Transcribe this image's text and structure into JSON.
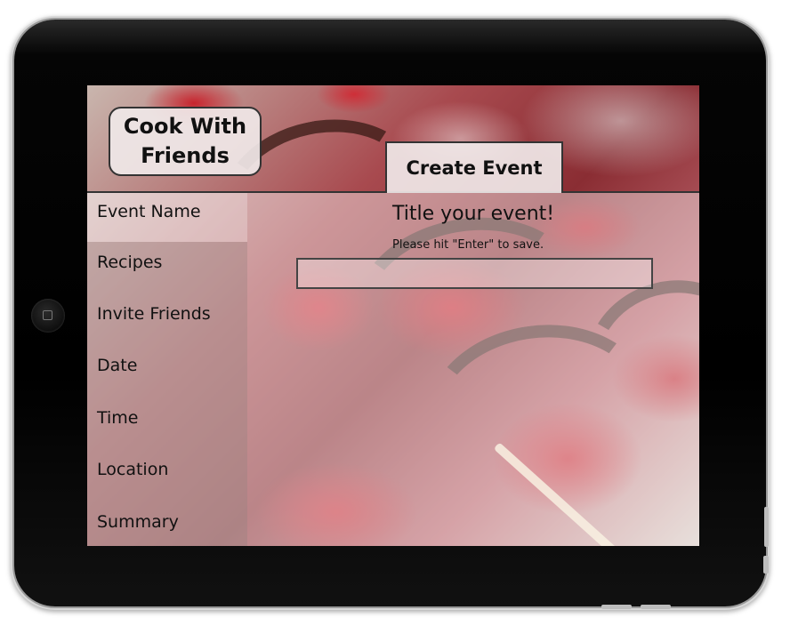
{
  "app": {
    "logo_text": "Cook With Friends",
    "logo_line1": "Cook With",
    "logo_line2": "Friends"
  },
  "header": {
    "active_tab": "Create Event"
  },
  "sidebar": {
    "items": [
      {
        "label": "Event Name",
        "selected": true
      },
      {
        "label": "Recipes",
        "selected": false
      },
      {
        "label": "Invite Friends",
        "selected": false
      },
      {
        "label": "Date",
        "selected": false
      },
      {
        "label": "Time",
        "selected": false
      },
      {
        "label": "Location",
        "selected": false
      },
      {
        "label": "Summary",
        "selected": false
      }
    ]
  },
  "main": {
    "title": "Title your event!",
    "hint": "Please hit \"Enter\" to save.",
    "event_name_input": {
      "value": "",
      "placeholder": ""
    }
  },
  "colors": {
    "device_bezel": "#000000",
    "text": "#111111",
    "button_fill": "#f0e8e8",
    "border": "#333333"
  },
  "icons": {
    "home_button": "home-button-icon",
    "background": "chocolate-strawberry-skewers-photo"
  }
}
